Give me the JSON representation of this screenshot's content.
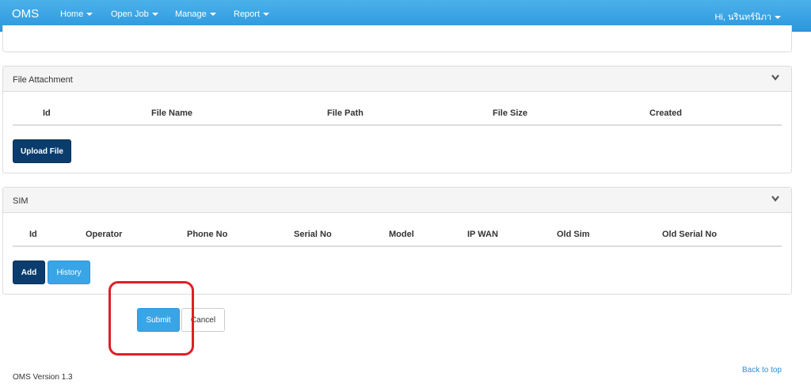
{
  "navbar": {
    "brand": "OMS",
    "items": [
      {
        "label": "Home"
      },
      {
        "label": "Open Job"
      },
      {
        "label": "Manage"
      },
      {
        "label": "Report"
      }
    ],
    "user": "Hi, นรินทร์นิภา"
  },
  "file_attachment": {
    "title": "File Attachment",
    "columns": [
      "Id",
      "File Name",
      "File Path",
      "File Size",
      "Created"
    ],
    "upload_label": "Upload File"
  },
  "sim": {
    "title": "SIM",
    "columns": [
      "Id",
      "Operator",
      "Phone No",
      "Serial No",
      "Model",
      "IP WAN",
      "Old Sim",
      "Old Serial No"
    ],
    "add_label": "Add",
    "history_label": "History"
  },
  "actions": {
    "submit_label": "Submit",
    "cancel_label": "Cancel"
  },
  "footer": {
    "version": "OMS Version 1.3",
    "back_to_top": "Back to top"
  },
  "colors": {
    "navbar": "#2c97dd",
    "dark_button": "#0a3d6e",
    "light_button": "#3aa5e6",
    "highlight": "#e01e26"
  }
}
